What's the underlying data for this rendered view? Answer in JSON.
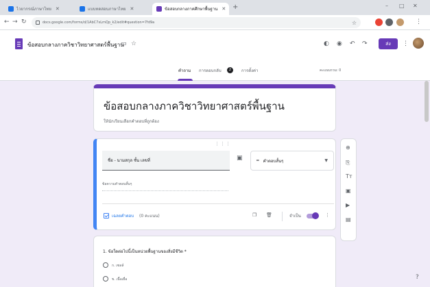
{
  "browser": {
    "tabs": [
      {
        "label": "ไวยากรณ์ภาษาไทย",
        "color": "#1a73e8"
      },
      {
        "label": "แบบทดสอบภาษาไทย",
        "color": "#1a73e8"
      },
      {
        "label": "ข้อสอบกลางภาคศึกษาพื้นฐาน",
        "color": "#673ab7"
      }
    ],
    "new_tab": "+",
    "url": "docs.google.com/forms/d/1AbC7xLmQp_k2/edit#question=7fd9a",
    "window_controls": [
      "–",
      "□",
      "✕"
    ]
  },
  "form_header": {
    "doc_title": "ข้อสอบกลางภาควิชาวิทยาศาสตร์พื้นฐาน",
    "send_label": "ส่ง",
    "tabs": {
      "questions": "คำถาม",
      "responses": "การตอบกลับ",
      "responses_count": "2",
      "settings": "การตั้งค่า"
    },
    "total_points": "คะแนนรวม: 0"
  },
  "title_card": {
    "title": "ข้อสอบกลางภาควิชาวิทยาศาสตร์พื้นฐาน",
    "description": "ให้นักเรียนเลือกคำตอบที่ถูกต้อง"
  },
  "question_card": {
    "question_value": "ชื่อ - นามสกุล ชั้น เลขที่",
    "type_label": "คำตอบสั้นๆ",
    "short_answer_hint": "ข้อความคำตอบสั้นๆ",
    "answer_key": "เฉลยคำตอบ",
    "points": "(0 คะแนน)",
    "required_label": "จำเป็น"
  },
  "question2": {
    "text": "1. ข้อใดต่อไปนี้เป็นหน่วยพื้นฐานของสิ่งมีชีวิต *",
    "options": [
      "ก. เซลล์",
      "ข. เนื้อเยื่อ"
    ]
  },
  "colors": {
    "accent": "#673ab7",
    "background": "#f0ebf8",
    "focus": "#4285f4"
  },
  "icons": {
    "folder": "folder-icon",
    "star": "star-icon",
    "palette": "palette-icon",
    "preview": "eye-icon",
    "undo": "undo-icon",
    "redo": "redo-icon",
    "more": "more-vert-icon"
  }
}
